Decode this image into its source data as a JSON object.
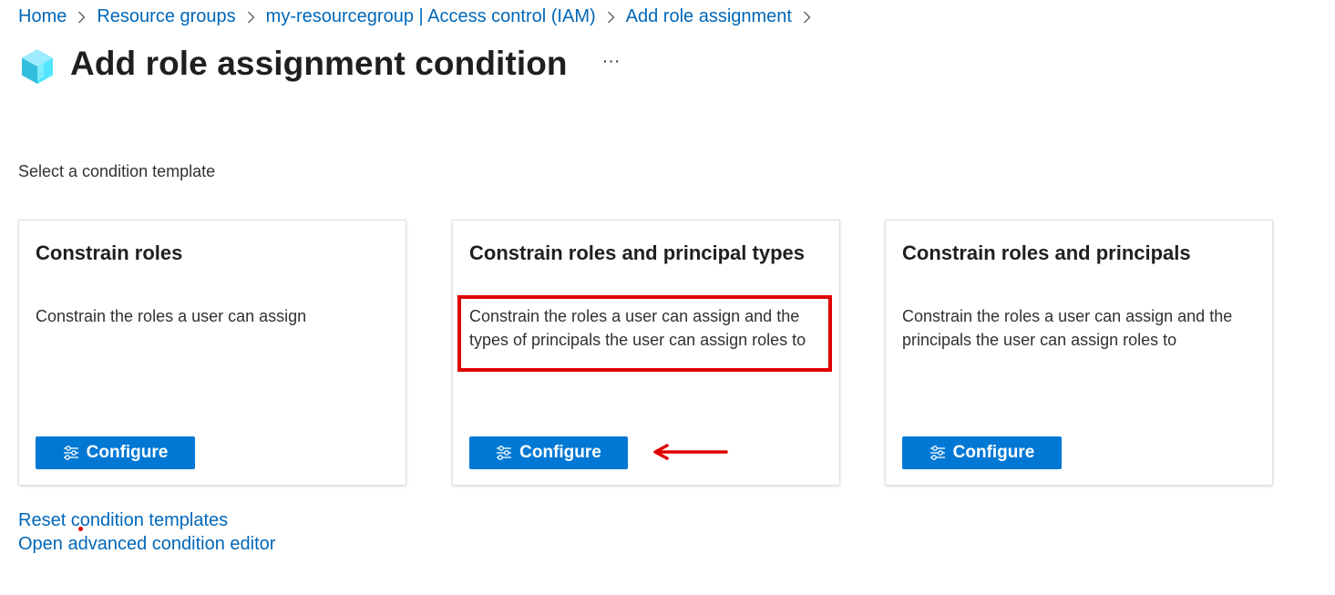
{
  "breadcrumb": {
    "items": [
      {
        "label": "Home"
      },
      {
        "label": "Resource groups"
      },
      {
        "label": "my-resourcegroup | Access control (IAM)"
      },
      {
        "label": "Add role assignment"
      }
    ]
  },
  "header": {
    "title": "Add role assignment condition",
    "more_label": "···",
    "icon": "cube-icon"
  },
  "section": {
    "label": "Select a condition template"
  },
  "cards": [
    {
      "title": "Constrain roles",
      "description": "Constrain the roles a user can assign",
      "button_label": "Configure"
    },
    {
      "title": "Constrain roles and principal types",
      "description": "Constrain the roles a user can assign and the types of principals the user can assign roles to",
      "button_label": "Configure"
    },
    {
      "title": "Constrain roles and principals",
      "description": "Constrain the roles a user can assign and the principals the user can assign roles to",
      "button_label": "Configure"
    }
  ],
  "links": {
    "reset": "Reset condition templates",
    "advanced": "Open advanced condition editor"
  },
  "colors": {
    "accent": "#0078d4",
    "link": "#0067b8",
    "annotation": "#e00000"
  }
}
